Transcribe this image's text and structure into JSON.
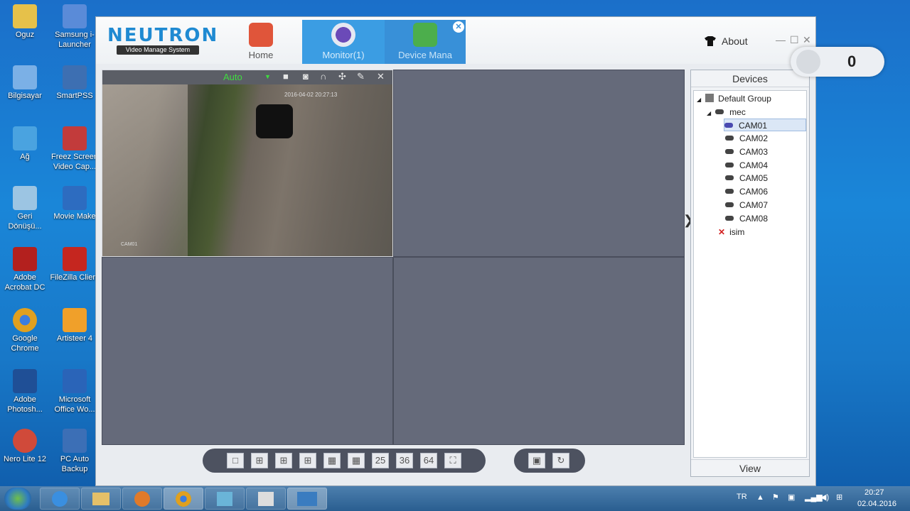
{
  "desktop": {
    "icons": [
      {
        "label": "Oguz",
        "color": "#e6c14a"
      },
      {
        "label": "Samsung i-Launcher",
        "color": "#5a8bd8"
      },
      {
        "label": "Bilgisayar",
        "color": "#7bb0e6"
      },
      {
        "label": "SmartPSS",
        "color": "#3d6fb2"
      },
      {
        "label": "Ağ",
        "color": "#4aa3e0"
      },
      {
        "label": "Freez Screen Video Cap...",
        "color": "#c23b3b"
      },
      {
        "label": "Geri Dönüşü...",
        "color": "#9cc5e3"
      },
      {
        "label": "Movie Make",
        "color": "#2d6cc0"
      },
      {
        "label": "Adobe Acrobat DC",
        "color": "#b3201e"
      },
      {
        "label": "FileZilla Client",
        "color": "#c5261f"
      },
      {
        "label": "Google Chrome",
        "color": "#e0a020"
      },
      {
        "label": "Artisteer 4",
        "color": "#f0a02a"
      },
      {
        "label": "Adobe Photosh...",
        "color": "#1f4f96"
      },
      {
        "label": "Microsoft Office Wo...",
        "color": "#2a64b8"
      },
      {
        "label": "Nero Lite 12",
        "color": "#d04a3a"
      },
      {
        "label": "PC Auto Backup",
        "color": "#3c6fb6"
      }
    ]
  },
  "app": {
    "logo": {
      "brand": "NEUTRON",
      "sub": "Video Manage System"
    },
    "tabs": [
      {
        "label": "Home",
        "icon": "home-icon"
      },
      {
        "label": "Monitor(1)",
        "icon": "monitor-icon"
      },
      {
        "label": "Device Mana",
        "icon": "device-manager-icon"
      }
    ],
    "about": "About",
    "camera": {
      "stream_mode": "Auto",
      "timestamp": "2016-04-02 20:27:13",
      "overlay_label": "CAM01"
    },
    "layout_buttons": [
      "25",
      "36",
      "64"
    ],
    "devices": {
      "header": "Devices",
      "group": "Default Group",
      "device": "mec",
      "cameras": [
        "CAM01",
        "CAM02",
        "CAM03",
        "CAM04",
        "CAM05",
        "CAM06",
        "CAM07",
        "CAM08"
      ],
      "selected": "CAM01",
      "offline_device": "isim",
      "view_button": "View"
    },
    "counter": "0"
  },
  "taskbar": {
    "language": "TR",
    "time": "20:27",
    "date": "02.04.2016"
  }
}
